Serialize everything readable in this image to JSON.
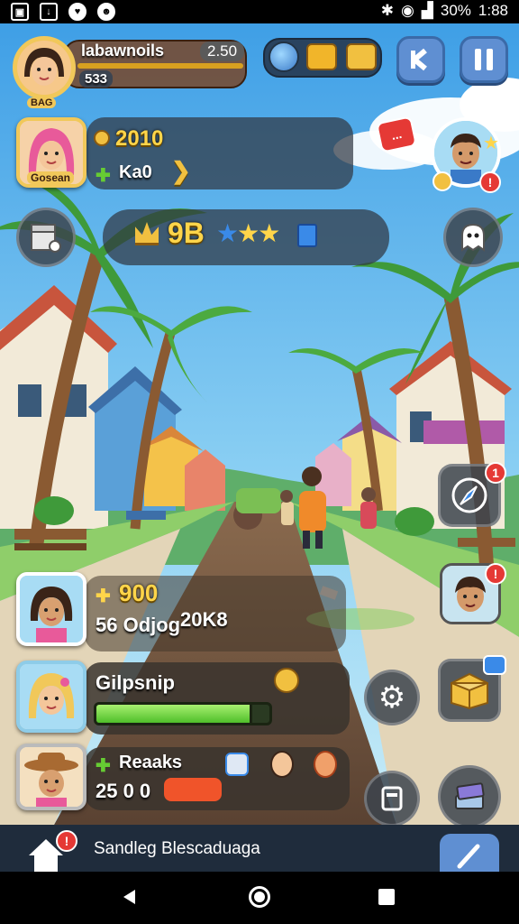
{
  "status_bar": {
    "battery": "30%",
    "time": "1:88"
  },
  "player": {
    "name": "labawnoils",
    "score": "2.50",
    "level_badge": "533",
    "sub_badge": "BAG"
  },
  "friend_card": {
    "name": "Gosean",
    "coins": "2010",
    "gems": "Ka0"
  },
  "rating_bar": {
    "value": "9B"
  },
  "chat_bubble": "...",
  "cards": [
    {
      "coins": "900",
      "subtitle": "56 Odjog",
      "extra": "20K8"
    },
    {
      "title": "Gilpsnip",
      "progress": 0.9
    },
    {
      "title": "Reaaks",
      "value": "25 0 0"
    }
  ],
  "bottom_banner": "Sandleg Blescaduaga",
  "colors": {
    "accent_blue": "#5f8fd2",
    "progress_green": "#66dd33",
    "badge_red": "#e53935",
    "gold_text": "#ffd54a"
  },
  "icons": {
    "back": "back-arrow-icon",
    "pause": "pause-icon",
    "settings": "gear-icon",
    "home": "home-icon",
    "edit": "pencil-icon"
  }
}
